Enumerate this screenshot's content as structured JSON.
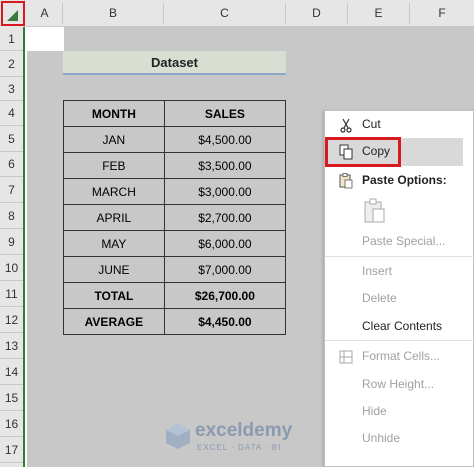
{
  "columns": [
    "A",
    "B",
    "C",
    "D",
    "E",
    "F"
  ],
  "rows": [
    "1",
    "2",
    "3",
    "4",
    "5",
    "6",
    "7",
    "8",
    "9",
    "10",
    "11",
    "12",
    "13",
    "14",
    "15",
    "16",
    "17"
  ],
  "dataset_title": "Dataset",
  "table": {
    "headers": [
      "MONTH",
      "SALES"
    ],
    "rows": [
      [
        "JAN",
        "$4,500.00"
      ],
      [
        "FEB",
        "$3,500.00"
      ],
      [
        "MARCH",
        "$3,000.00"
      ],
      [
        "APRIL",
        "$2,700.00"
      ],
      [
        "MAY",
        "$6,000.00"
      ],
      [
        "JUNE",
        "$7,000.00"
      ],
      [
        "TOTAL",
        "$26,700.00"
      ],
      [
        "AVERAGE",
        "$4,450.00"
      ]
    ],
    "bold_rows": [
      6,
      7
    ]
  },
  "context_menu": {
    "cut": "Cut",
    "copy": "Copy",
    "paste_options": "Paste Options:",
    "paste_special": "Paste Special...",
    "insert": "Insert",
    "delete": "Delete",
    "clear_contents": "Clear Contents",
    "format_cells": "Format Cells...",
    "row_height": "Row Height...",
    "hide": "Hide",
    "unhide": "Unhide"
  },
  "watermark": {
    "brand": "exceldemy",
    "tagline": "EXCEL · DATA · BI"
  },
  "colors": {
    "highlight_red": "#d71920",
    "header_green": "#2e7d32",
    "title_bg": "#d8dfd2"
  }
}
